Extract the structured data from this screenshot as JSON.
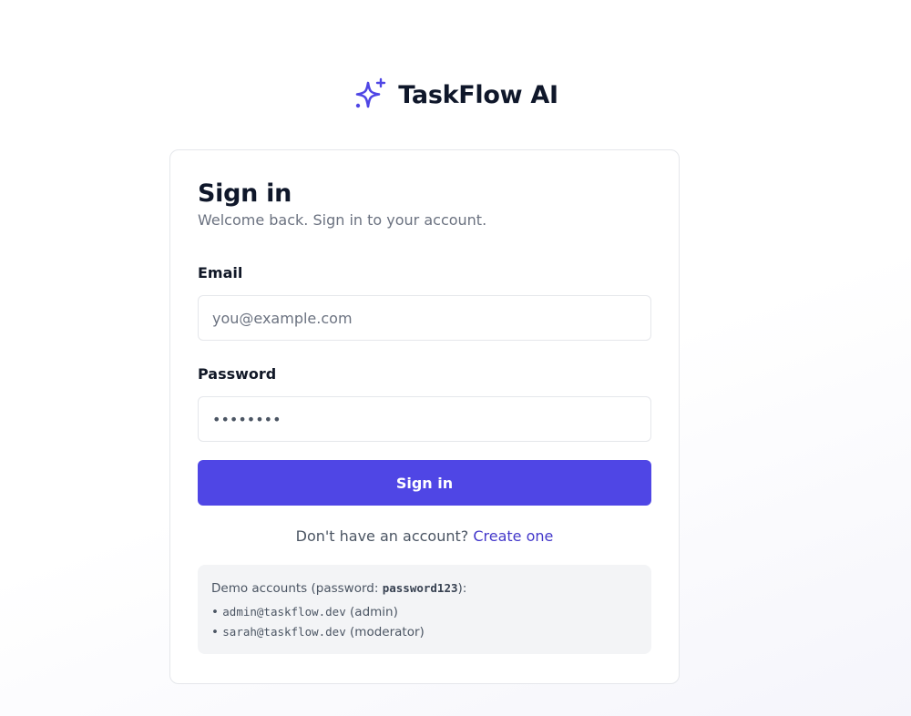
{
  "brand": {
    "name": "TaskFlow AI",
    "icon": "sparkles-icon",
    "accent_color": "#4f46e5"
  },
  "card": {
    "title": "Sign in",
    "subtitle": "Welcome back. Sign in to your account."
  },
  "form": {
    "email_label": "Email",
    "email_placeholder": "you@example.com",
    "email_value": "",
    "password_label": "Password",
    "password_value": "password",
    "submit_label": "Sign in"
  },
  "signup": {
    "prompt": "Don't have an account?",
    "link_label": "Create one"
  },
  "demo": {
    "title_prefix": "Demo accounts (password: ",
    "password": "password123",
    "title_suffix": "):",
    "accounts": [
      {
        "email": "admin@taskflow.dev",
        "role": "(admin)"
      },
      {
        "email": "sarah@taskflow.dev",
        "role": "(moderator)"
      }
    ]
  }
}
